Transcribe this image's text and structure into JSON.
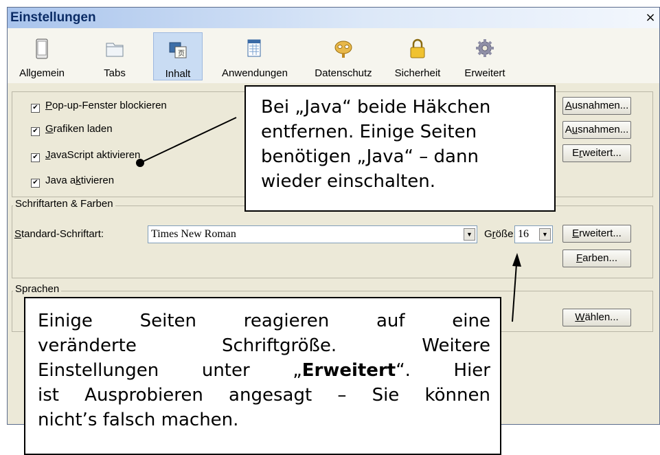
{
  "window": {
    "title": "Einstellungen",
    "close_glyph": "×"
  },
  "tabs": [
    {
      "label": "Allgemein",
      "icon": "phone-device-icon"
    },
    {
      "label": "Tabs",
      "icon": "tabs-folder-icon"
    },
    {
      "label": "Inhalt",
      "icon": "content-page-icon",
      "selected": true
    },
    {
      "label": "Anwendungen",
      "icon": "applications-icon"
    },
    {
      "label": "Datenschutz",
      "icon": "mask-icon"
    },
    {
      "label": "Sicherheit",
      "icon": "padlock-icon"
    },
    {
      "label": "Erweitert",
      "icon": "gear-icon"
    }
  ],
  "content": {
    "checkboxes": [
      {
        "pre": "",
        "acc": "P",
        "post": "op-up-Fenster blockieren",
        "checked": true
      },
      {
        "pre": "",
        "acc": "G",
        "post": "rafiken laden",
        "checked": true
      },
      {
        "pre": "",
        "acc": "J",
        "post": "avaScript aktivieren",
        "checked": true
      },
      {
        "pre": "Java a",
        "acc": "k",
        "post": "tivieren",
        "checked": true
      }
    ],
    "buttons": {
      "exceptions1": {
        "pre": "",
        "acc": "A",
        "post": "usnahmen..."
      },
      "exceptions2": {
        "pre": "A",
        "acc": "u",
        "post": "snahmen..."
      },
      "advanced": {
        "pre": "E",
        "acc": "r",
        "post": "weitert..."
      }
    }
  },
  "fonts": {
    "group_label": "Schriftarten & Farben",
    "default_font_label": {
      "acc": "S",
      "post": "tandard-Schriftart:"
    },
    "default_font_value": "Times New Roman",
    "size_label": {
      "pre": "G",
      "acc": "r",
      "post": "öße:"
    },
    "size_value": "16",
    "advanced_button": {
      "acc": "E",
      "post": "rweitert..."
    },
    "colors_button": {
      "acc": "F",
      "post": "arben..."
    }
  },
  "languages": {
    "group_label": "Sprachen",
    "choose_button": {
      "acc": "W",
      "post": "ählen..."
    }
  },
  "callouts": {
    "java": {
      "lines": [
        "Bei „Java“ beide Häkchen",
        "entfernen. Einige Seiten",
        "benötigen „Java“ – dann",
        "wieder einschalten."
      ]
    },
    "fontsize": {
      "line1": "Einige Seiten reagieren auf eine",
      "line2": "veränderte Schriftgröße. Weitere",
      "line3_pre": "Einstellungen unter „",
      "line3_bold": "Erweitert",
      "line3_post": "“. Hier",
      "line4": "ist Ausprobieren angesagt – Sie können",
      "line5": "nicht’s falsch machen."
    }
  }
}
